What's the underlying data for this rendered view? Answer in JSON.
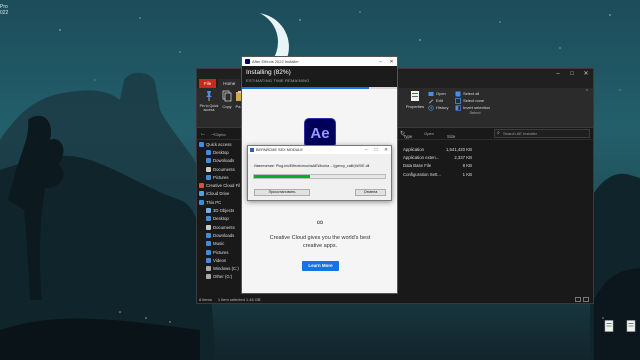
{
  "desktop": {
    "corner_lines": [
      "Pro",
      "022"
    ],
    "icons": [
      {
        "label": ""
      },
      {
        "label": ""
      }
    ]
  },
  "explorer": {
    "title": "",
    "tabs": [
      {
        "label": "File"
      },
      {
        "label": "Home"
      }
    ],
    "ribbon": {
      "clipboard": {
        "pin_label": "Pin to Quick access",
        "copy_label": "Copy",
        "paste_label": "Pa",
        "caption": "Clipbo"
      },
      "open": {
        "properties_label": "Properties",
        "open_label": "Open",
        "edit_label": "Edit",
        "history_label": "History",
        "caption": "Open"
      },
      "select": {
        "select_all_label": "Select all",
        "select_none_label": "Select none",
        "invert_label": "Invert selection",
        "caption": "Select"
      }
    },
    "search_placeholder": "Search AE Installer",
    "nav_items": [
      {
        "label": "Quick access",
        "level": 1,
        "color": "#3b8ee0"
      },
      {
        "label": "Desktop",
        "level": 2,
        "color": "#3b8ee0"
      },
      {
        "label": "Downloads",
        "level": 2,
        "color": "#3b8ee0"
      },
      {
        "label": "Documents",
        "level": 2,
        "color": "#cccccc"
      },
      {
        "label": "Pictures",
        "level": 2,
        "color": "#3b8ee0"
      },
      {
        "label": "Creative Cloud Fil",
        "level": 1,
        "color": "#e24a3b"
      },
      {
        "label": "iCloud Drive",
        "level": 1,
        "color": "#4aa3e0"
      },
      {
        "label": "This PC",
        "level": 1,
        "color": "#3b8ee0"
      },
      {
        "label": "3D Objects",
        "level": 2,
        "color": "#6fb1e8"
      },
      {
        "label": "Desktop",
        "level": 2,
        "color": "#3b8ee0"
      },
      {
        "label": "Documents",
        "level": 2,
        "color": "#cccccc"
      },
      {
        "label": "Downloads",
        "level": 2,
        "color": "#3b8ee0"
      },
      {
        "label": "Music",
        "level": 2,
        "color": "#3b8ee0"
      },
      {
        "label": "Pictures",
        "level": 2,
        "color": "#3b8ee0"
      },
      {
        "label": "Videos",
        "level": 2,
        "color": "#3b8ee0"
      },
      {
        "label": "Windows (C:)",
        "level": 2,
        "color": "#aaaaaa"
      },
      {
        "label": "Other (G:)",
        "level": 2,
        "color": "#aaaaaa"
      }
    ],
    "columns": {
      "type": "Type",
      "size": "Size"
    },
    "files": [
      {
        "type": "Application",
        "size": "1,541,420 KB"
      },
      {
        "type": "Application exten...",
        "size": "2,337 KB"
      },
      {
        "type": "Data Base File",
        "size": "8 KB"
      },
      {
        "type": "Configuration Sett...",
        "size": "1 KB"
      }
    ],
    "status": {
      "count": "8 items",
      "selected": "1 item selected 1.46 GB"
    }
  },
  "installer": {
    "window_title": "After Effects 2022 Installer",
    "heading": "Installing (82%)",
    "subheading": "ESTIMATING TIME REMAINING",
    "progress": 0.82,
    "app_badge": "Ae",
    "cc_text": "Creative Cloud gives you the world's best creative apps.",
    "learn_more": "Learn More"
  },
  "dialog": {
    "title": "ВЕРАЙСМЕ SEX MODULE",
    "message": "Извлечение: Plug-ins\\Effects\\mochaAE\\Mocha ...\\(gency_calib)\\WXE.dll",
    "progress": 0.43,
    "pause_label": "Приостановить",
    "cancel_label": "Отмена"
  }
}
